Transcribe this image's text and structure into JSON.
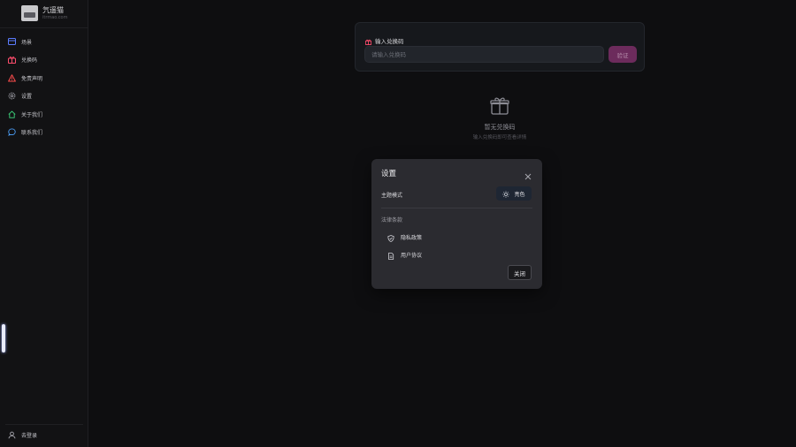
{
  "brand": {
    "name": "氕遥猫",
    "subtitle": "itrmao.com"
  },
  "sidebar": {
    "items": [
      {
        "label": "场景",
        "icon": "card-icon",
        "color": "#5b7cff"
      },
      {
        "label": "兑换码",
        "icon": "gift-icon",
        "color": "#ff4d6d"
      },
      {
        "label": "免责声明",
        "icon": "warning-icon",
        "color": "#ff4d4d"
      },
      {
        "label": "设置",
        "icon": "gear-icon",
        "color": "#9a9aa2"
      },
      {
        "label": "关于我们",
        "icon": "home-icon",
        "color": "#38c172"
      },
      {
        "label": "联系我们",
        "icon": "chat-icon",
        "color": "#4da3ff"
      }
    ],
    "login_label": "去登录"
  },
  "redeem": {
    "title": "输入兑换码",
    "placeholder": "请输入兑换码",
    "verify_label": "验证"
  },
  "empty_state": {
    "title": "暂无兑换码",
    "subtitle": "输入兑换码即可查看详情"
  },
  "settings_modal": {
    "title": "设置",
    "theme_label": "主题模式",
    "theme_value": "亮色",
    "legal_label": "法律条款",
    "legal_items": [
      {
        "label": "隐私政策",
        "icon": "shield-icon"
      },
      {
        "label": "用户协议",
        "icon": "document-icon"
      }
    ],
    "close_label": "关闭"
  },
  "colors": {
    "accent": "#6c2b5c",
    "background": "#0e0e10",
    "modal": "#2b2b30"
  }
}
